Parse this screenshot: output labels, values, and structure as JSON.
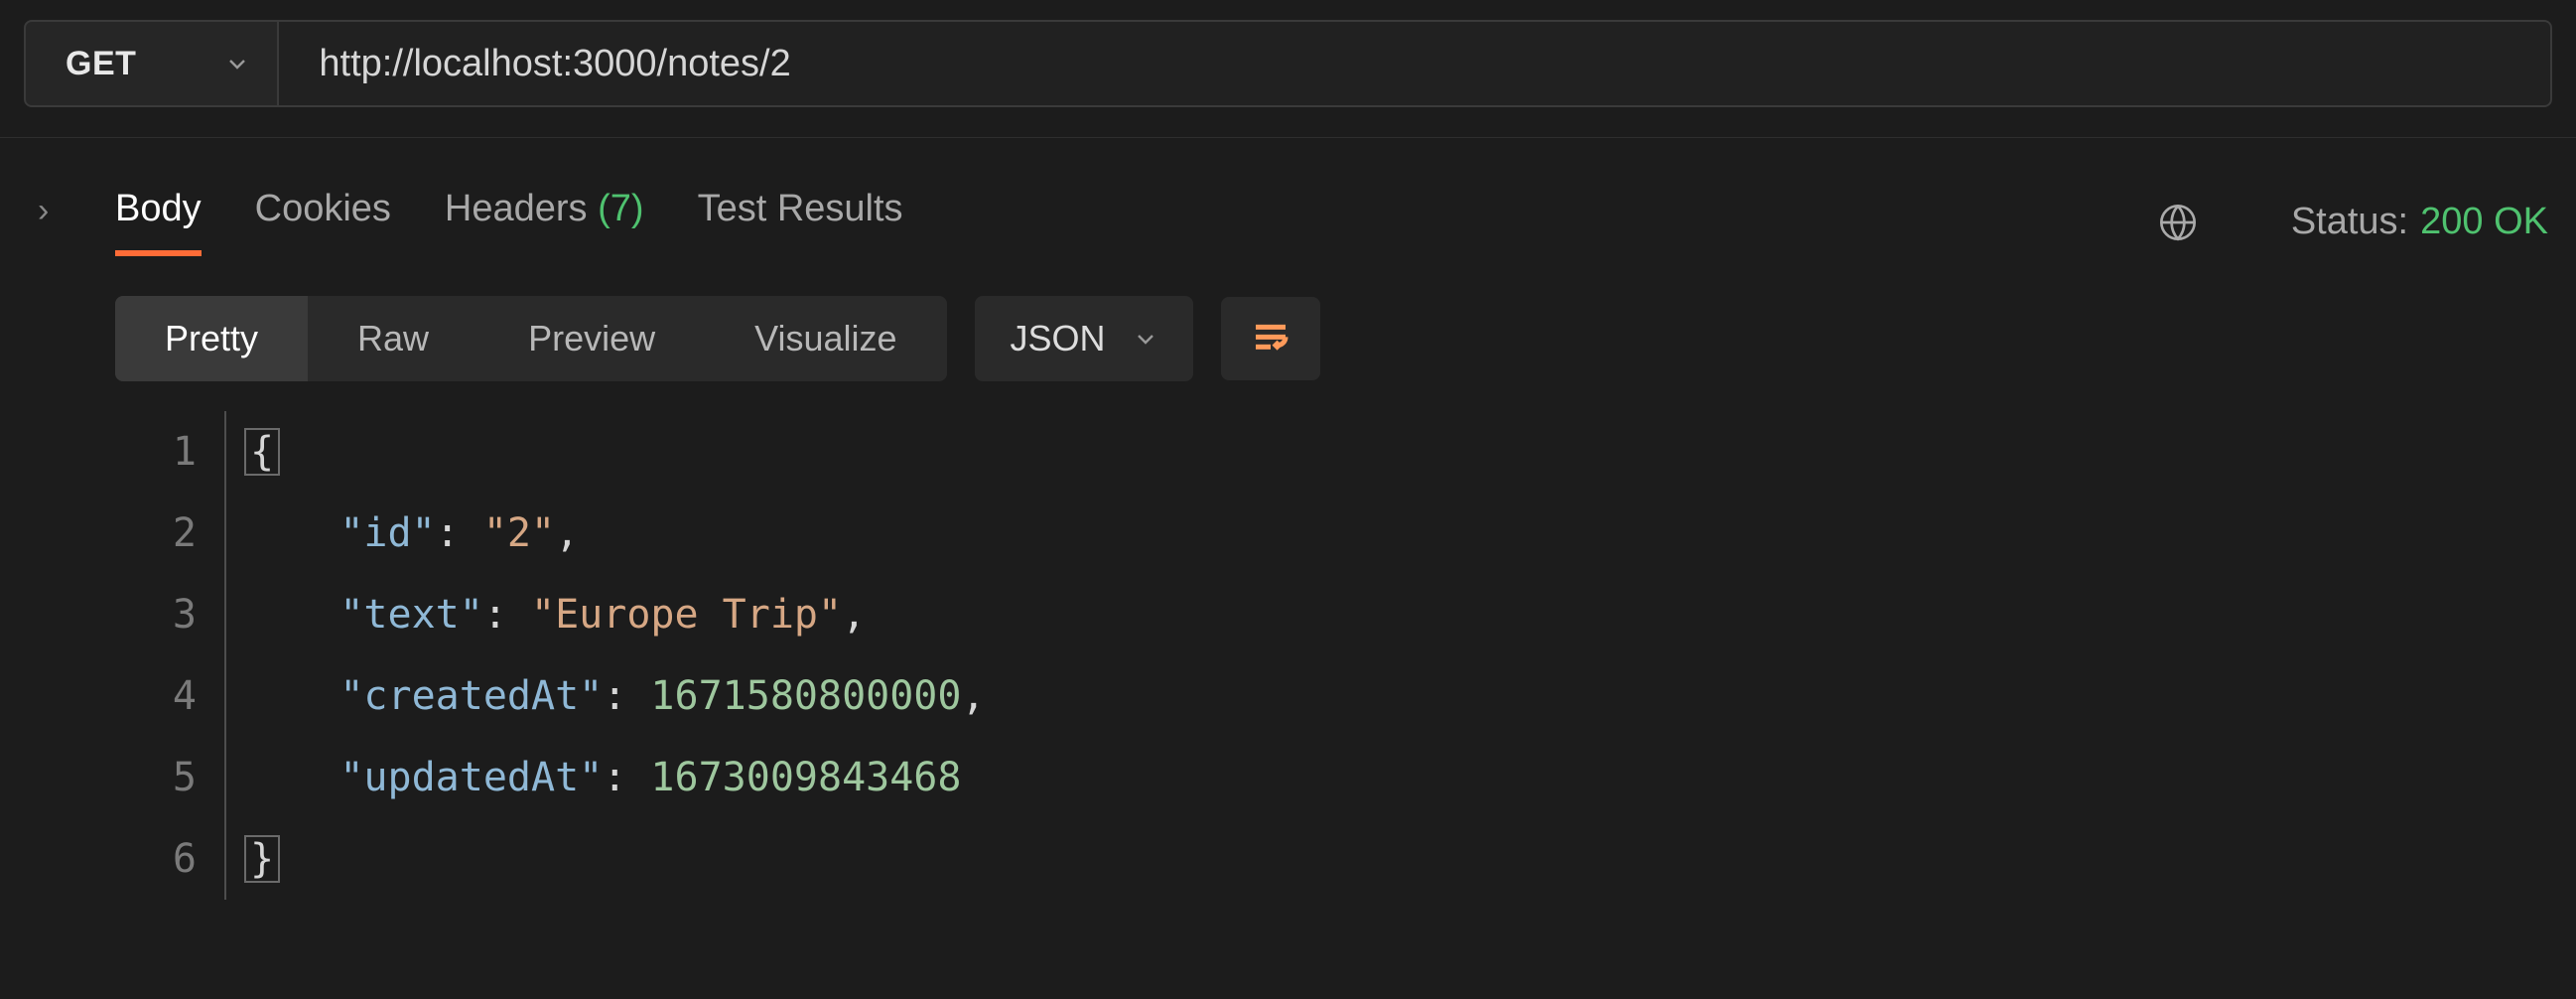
{
  "request": {
    "method": "GET",
    "url": "http://localhost:3000/notes/2"
  },
  "tabs": {
    "body": "Body",
    "cookies": "Cookies",
    "headers": "Headers",
    "headers_count": "(7)",
    "test_results": "Test Results"
  },
  "status": {
    "label": "Status:",
    "value": "200 OK"
  },
  "viewmodes": {
    "pretty": "Pretty",
    "raw": "Raw",
    "preview": "Preview",
    "visualize": "Visualize"
  },
  "format_dd": "JSON",
  "response_json": {
    "id": "2",
    "text": "Europe Trip",
    "createdAt": 1671580800000,
    "updatedAt": 1673009843468
  },
  "code_lines": [
    {
      "n": "1",
      "raw": "{"
    },
    {
      "n": "2",
      "indent": "    ",
      "key": "\"id\"",
      "sep": ": ",
      "val": "\"2\"",
      "type": "str",
      "comma": ","
    },
    {
      "n": "3",
      "indent": "    ",
      "key": "\"text\"",
      "sep": ": ",
      "val": "\"Europe Trip\"",
      "type": "str",
      "comma": ","
    },
    {
      "n": "4",
      "indent": "    ",
      "key": "\"createdAt\"",
      "sep": ": ",
      "val": "1671580800000",
      "type": "num",
      "comma": ","
    },
    {
      "n": "5",
      "indent": "    ",
      "key": "\"updatedAt\"",
      "sep": ": ",
      "val": "1673009843468",
      "type": "num",
      "comma": ""
    },
    {
      "n": "6",
      "raw": "}"
    }
  ]
}
